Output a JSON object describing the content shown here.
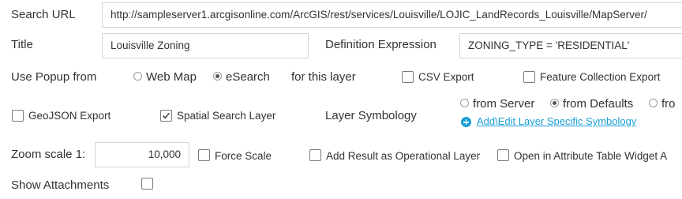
{
  "search_url": {
    "label": "Search URL",
    "value": "http://sampleserver1.arcgisonline.com/ArcGIS/rest/services/Louisville/LOJIC_LandRecords_Louisville/MapServer/"
  },
  "title": {
    "label": "Title",
    "value": "Louisville Zoning"
  },
  "definition_expression": {
    "label": "Definition Expression",
    "value": "ZONING_TYPE = 'RESIDENTIAL'"
  },
  "popup": {
    "label": "Use Popup from",
    "options": [
      {
        "label": "Web Map",
        "selected": false
      },
      {
        "label": "eSearch",
        "selected": true
      }
    ],
    "suffix": "for this layer"
  },
  "csv_export": {
    "label": "CSV Export",
    "checked": false
  },
  "feature_collection_export": {
    "label": "Feature Collection Export",
    "checked": false
  },
  "geojson_export": {
    "label": "GeoJSON Export",
    "checked": false
  },
  "spatial_search_layer": {
    "label": "Spatial Search Layer",
    "checked": true
  },
  "symbology": {
    "label": "Layer Symbology",
    "options": [
      {
        "label": "from Server",
        "selected": false
      },
      {
        "label": "from Defaults",
        "selected": true
      },
      {
        "label": "fro",
        "selected": false
      }
    ],
    "link": "Add\\Edit Layer Specific Symbology"
  },
  "zoom_scale": {
    "label": "Zoom scale 1:",
    "value": "10,000"
  },
  "force_scale": {
    "label": "Force Scale",
    "checked": false
  },
  "add_result_operational": {
    "label": "Add Result as Operational Layer",
    "checked": false
  },
  "open_attribute_table": {
    "label": "Open in Attribute Table Widget A",
    "checked": false
  },
  "show_attachments": {
    "label": "Show Attachments",
    "checked": false
  },
  "colors": {
    "link": "#1a9fd6",
    "border": "#d4d4d4",
    "text": "#333333"
  }
}
